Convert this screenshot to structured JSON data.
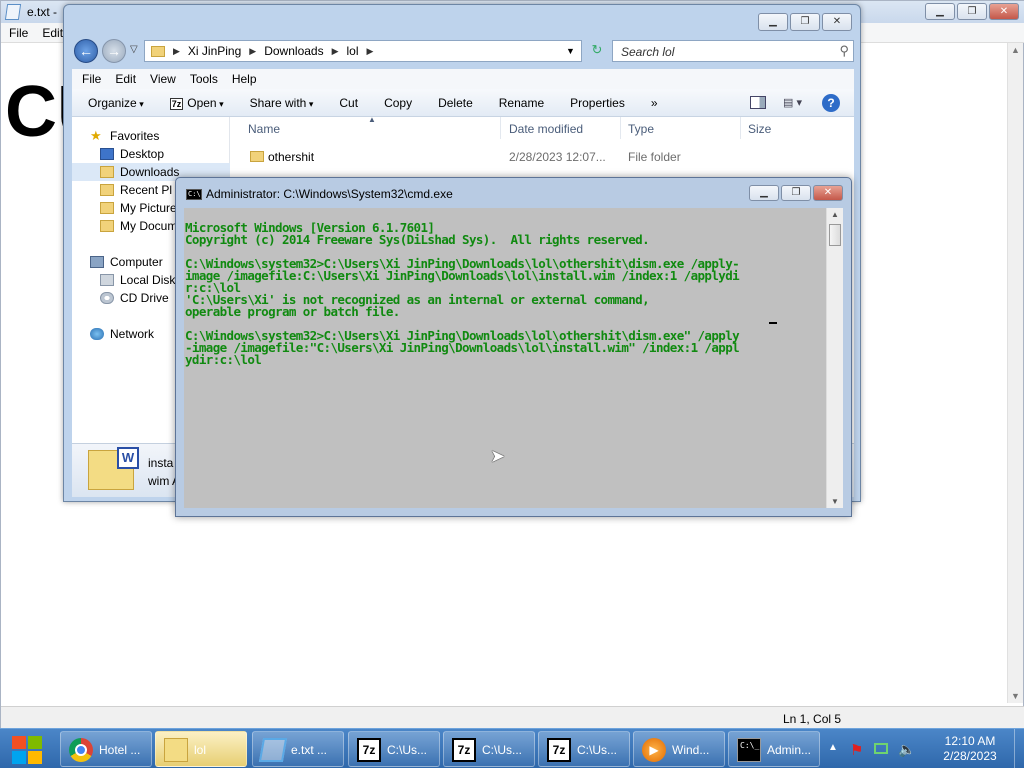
{
  "notepad": {
    "title": "e.txt -",
    "menu": [
      "File",
      "Edit"
    ],
    "content_fragment": "CU",
    "status": "Ln 1, Col 5"
  },
  "explorer": {
    "breadcrumb": [
      "Xi JinPing",
      "Downloads",
      "lol"
    ],
    "search_placeholder": "Search lol",
    "menu": [
      "File",
      "Edit",
      "View",
      "Tools",
      "Help"
    ],
    "toolbar": {
      "organize": "Organize",
      "open": "Open",
      "open_badge": "7z",
      "share_with": "Share with",
      "cut": "Cut",
      "copy": "Copy",
      "delete": "Delete",
      "rename": "Rename",
      "properties": "Properties",
      "more": "»"
    },
    "nav": {
      "favorites": "Favorites",
      "desktop": "Desktop",
      "downloads": "Downloads",
      "recent": "Recent Pl",
      "pictures": "My Picture",
      "documents": "My Docum",
      "computer": "Computer",
      "local_disk": "Local Disk",
      "cd_drive": "CD Drive",
      "network": "Network"
    },
    "columns": {
      "name": "Name",
      "date": "Date modified",
      "type": "Type",
      "size": "Size"
    },
    "rows": [
      {
        "name": "othershit",
        "date": "2/28/2023 12:07...",
        "type": "File folder",
        "size": ""
      }
    ],
    "details": {
      "line1": "insta",
      "line2": "wim A"
    }
  },
  "cmd": {
    "title": "Administrator: C:\\Windows\\System32\\cmd.exe",
    "lines": [
      "Microsoft Windows [Version 6.1.7601]",
      "Copyright (c) 2014 Freeware Sys(DiLshad Sys).  All rights reserved.",
      "",
      "C:\\Windows\\system32>C:\\Users\\Xi JinPing\\Downloads\\lol\\othershit\\dism.exe /apply-",
      "image /imagefile:C:\\Users\\Xi JinPing\\Downloads\\lol\\install.wim /index:1 /applydi",
      "r:c:\\lol",
      "'C:\\Users\\Xi' is not recognized as an internal or external command,",
      "operable program or batch file.",
      "",
      "C:\\Windows\\system32>C:\\Users\\Xi JinPing\\Downloads\\lol\\othershit\\dism.exe\" /apply",
      "-image /imagefile:\"C:\\Users\\Xi JinPing\\Downloads\\lol\\install.wim\" /index:1 /appl",
      "ydir:c:\\lol"
    ]
  },
  "taskbar": {
    "buttons": [
      {
        "label": "Hotel ...",
        "icon": "chrome-icon"
      },
      {
        "label": "lol",
        "icon": "folder-icon"
      },
      {
        "label": "e.txt ...",
        "icon": "notepad-icon"
      },
      {
        "label": "C:\\Us...",
        "icon": "7zip-icon"
      },
      {
        "label": "C:\\Us...",
        "icon": "7zip-icon"
      },
      {
        "label": "C:\\Us...",
        "icon": "7zip-icon"
      },
      {
        "label": "Wind...",
        "icon": "media-player-icon"
      },
      {
        "label": "Admin...",
        "icon": "cmd-icon"
      }
    ],
    "clock_time": "12:10 AM",
    "clock_date": "2/28/2023"
  }
}
